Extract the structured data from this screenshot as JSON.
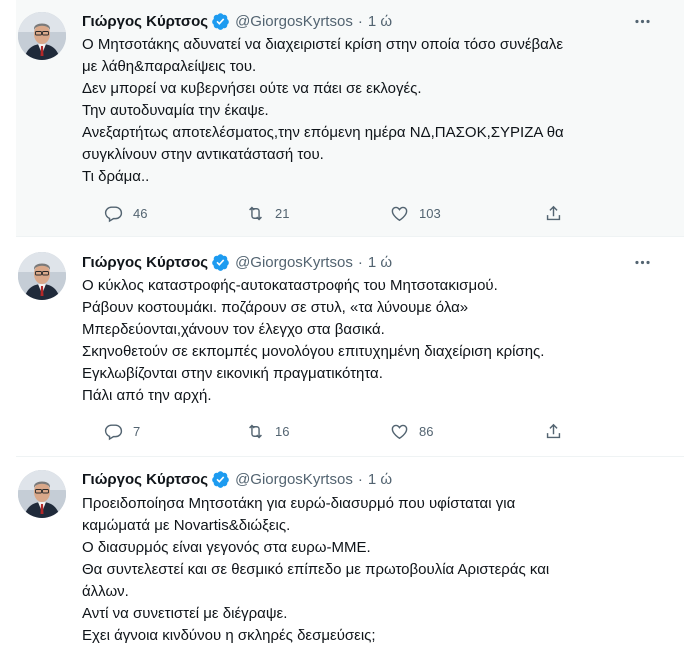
{
  "tweets": [
    {
      "name": "Γιώργος Κύρτσος",
      "handle": "@GiorgosKyrtsos",
      "separator": "·",
      "time": "1 ώ",
      "lines": [
        "Ο Μητσοτάκης αδυνατεί να διαχειριστεί κρίση στην οποία τόσο συνέβαλε",
        "με λάθη&παραλείψεις του.",
        "Δεν μπορεί να κυβερνήσει ούτε να πάει σε εκλογές.",
        "Την αυτοδυναμία την έκαψε.",
        "Ανεξαρτήτως αποτελέσματος,την επόμενη ημέρα ΝΔ,ΠΑΣΟΚ,ΣΥΡΙΖΑ θα",
        "συγκλίνουν στην αντικατάστασή του.",
        "Τι δράμα.."
      ],
      "replies": "46",
      "retweets": "21",
      "likes": "103"
    },
    {
      "name": "Γιώργος Κύρτσος",
      "handle": "@GiorgosKyrtsos",
      "separator": "·",
      "time": "1 ώ",
      "lines": [
        "Ο κύκλος καταστροφής-αυτοκαταστροφής του Μητσοτακισμού.",
        "Ράβουν κοστουμάκι. ποζάρουν σε στυλ, «τα λύνουμε όλα»",
        "Μπερδεύονται,χάνουν τον έλεγχο στα βασικά.",
        "Σκηνοθετούν σε εκπομπές μονολόγου επιτυχημένη διαχείριση κρίσης.",
        "Εγκλωβίζονται στην εικονική πραγματικότητα.",
        "Πάλι από την αρχή."
      ],
      "replies": "7",
      "retweets": "16",
      "likes": "86"
    },
    {
      "name": "Γιώργος Κύρτσος",
      "handle": "@GiorgosKyrtsos",
      "separator": "·",
      "time": "1 ώ",
      "lines": [
        "Προειδοποίησα Μητσοτάκη για ευρώ-διασυρμό που υφίσταται για",
        "καμώματά με Novartis&διώξεις.",
        "Ο διασυρμός είναι γεγονός στα  ευρω-ΜΜΕ.",
        "Θα συντελεστεί και σε θεσμικό επίπεδο με πρωτοβουλία Αριστεράς και",
        "άλλων.",
        "Αντί να συνετιστεί με διέγραψε.",
        "Εχει άγνοια κινδύνου η σκληρές δεσμεύσεις;"
      ]
    }
  ],
  "icons": {
    "reply": "reply-icon",
    "retweet": "retweet-icon",
    "like": "heart-icon",
    "share": "share-icon",
    "more": "more-icon",
    "verified": "verified-badge-icon"
  },
  "colors": {
    "text": "#0f1419",
    "secondary": "#536471",
    "verified": "#1d9bf0",
    "divider": "#eff3f4",
    "hover_bg": "#f7f9f9"
  }
}
